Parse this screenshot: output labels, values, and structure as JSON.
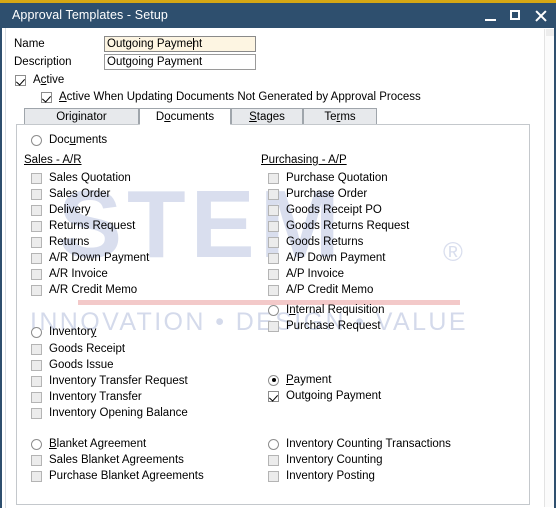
{
  "window": {
    "title": "Approval Templates - Setup",
    "accent_gold": "#d6a713",
    "titlebar_color": "#2e4f6e",
    "buttons": {
      "minimize": "Minimize",
      "maximize": "Maximize",
      "close": "Close"
    }
  },
  "watermark": {
    "logo": "STEM",
    "registered": "®",
    "tagline": "INNOVATION • DESIGN • VALUE",
    "logo_color": "#c3cbe4",
    "line_color": "#f3c9c9"
  },
  "form": {
    "name_label": "Name",
    "name_value": "Outgoing Payment",
    "description_label": "Description",
    "description_value": "Outgoing Payment",
    "active_label": "Active",
    "active_checked": true,
    "active_updating_label": "Active When Updating Documents Not Generated by Approval Process",
    "active_updating_checked": true
  },
  "tabs": [
    {
      "label": "Originator",
      "active": false
    },
    {
      "label": "Documents",
      "active": true
    },
    {
      "label": "Stages",
      "active": false
    },
    {
      "label": "Terms",
      "active": false
    }
  ],
  "documents_tab": {
    "root_radio": {
      "label": "Documents",
      "selected": false
    },
    "groups": [
      {
        "id": "sales-ar",
        "heading": "Sales - A/R",
        "items": [
          {
            "label": "Sales Quotation",
            "checked": false
          },
          {
            "label": "Sales Order",
            "checked": false
          },
          {
            "label": "Delivery",
            "checked": false
          },
          {
            "label": "Returns Request",
            "checked": false
          },
          {
            "label": "Returns",
            "checked": false
          },
          {
            "label": "A/R Down Payment",
            "checked": false
          },
          {
            "label": "A/R Invoice",
            "checked": false
          },
          {
            "label": "A/R Credit Memo",
            "checked": false
          }
        ]
      },
      {
        "id": "purchasing-ap",
        "heading": "Purchasing - A/P",
        "items": [
          {
            "label": "Purchase Quotation",
            "checked": false
          },
          {
            "label": "Purchase Order",
            "checked": false
          },
          {
            "label": "Goods Receipt PO",
            "checked": false
          },
          {
            "label": "Goods Returns Request",
            "checked": false
          },
          {
            "label": "Goods Returns",
            "checked": false
          },
          {
            "label": "A/P Down Payment",
            "checked": false
          },
          {
            "label": "A/P Invoice",
            "checked": false
          },
          {
            "label": "A/P Credit Memo",
            "checked": false
          }
        ]
      }
    ],
    "sections": [
      {
        "id": "internal-requisition",
        "radio": {
          "label": "Internal Requisition",
          "selected": false
        },
        "items": [
          {
            "label": "Purchase Request",
            "checked": false
          }
        ]
      },
      {
        "id": "inventory",
        "radio": {
          "label": "Inventory",
          "selected": false
        },
        "items": [
          {
            "label": "Goods Receipt",
            "checked": false
          },
          {
            "label": "Goods Issue",
            "checked": false
          },
          {
            "label": "Inventory Transfer Request",
            "checked": false
          },
          {
            "label": "Inventory Transfer",
            "checked": false
          },
          {
            "label": "Inventory Opening Balance",
            "checked": false
          }
        ]
      },
      {
        "id": "payment",
        "radio": {
          "label": "Payment",
          "selected": true
        },
        "items": [
          {
            "label": "Outgoing Payment",
            "checked": true
          }
        ]
      },
      {
        "id": "blanket-agreement",
        "radio": {
          "label": "Blanket Agreement",
          "selected": false
        },
        "items": [
          {
            "label": "Sales Blanket Agreements",
            "checked": false
          },
          {
            "label": "Purchase Blanket Agreements",
            "checked": false
          }
        ]
      },
      {
        "id": "inventory-counting",
        "radio": {
          "label": "Inventory Counting Transactions",
          "selected": false
        },
        "items": [
          {
            "label": "Inventory Counting",
            "checked": false
          },
          {
            "label": "Inventory Posting",
            "checked": false
          }
        ]
      }
    ]
  }
}
